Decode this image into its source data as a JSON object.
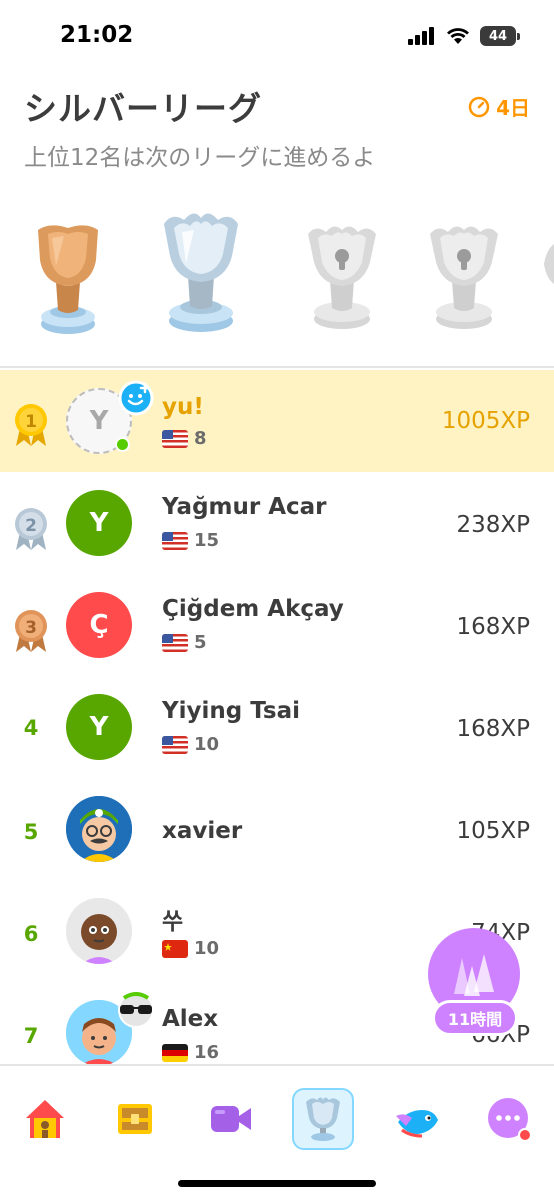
{
  "status_bar": {
    "time": "21:02",
    "battery": "44"
  },
  "header": {
    "title": "シルバーリーグ",
    "subtitle": "上位12名は次のリーグに進めるよ",
    "timer": "4日"
  },
  "trophies": [
    {
      "name": "bronze",
      "state": "unlocked"
    },
    {
      "name": "silver",
      "state": "current"
    },
    {
      "name": "locked-1",
      "state": "locked"
    },
    {
      "name": "locked-2",
      "state": "locked"
    }
  ],
  "leaderboard": [
    {
      "rank": "1",
      "name": "yu!",
      "initial": "Y",
      "streak": "8",
      "xp": "1005XP",
      "flag": "us",
      "me": true
    },
    {
      "rank": "2",
      "name": "Yağmur Acar",
      "initial": "Y",
      "streak": "15",
      "xp": "238XP",
      "flag": "us",
      "color": "#58a700"
    },
    {
      "rank": "3",
      "name": "Çiğdem Akçay",
      "initial": "Ç",
      "streak": "5",
      "xp": "168XP",
      "flag": "us",
      "color": "#ff4b4b"
    },
    {
      "rank": "4",
      "name": "Yiying Tsai",
      "initial": "Y",
      "streak": "10",
      "xp": "168XP",
      "flag": "us",
      "color": "#58a700"
    },
    {
      "rank": "5",
      "name": "xavier",
      "xp": "105XP"
    },
    {
      "rank": "6",
      "name": "쑤",
      "streak": "10",
      "xp": "74XP",
      "flag": "cn"
    },
    {
      "rank": "7",
      "name": "Alex",
      "streak": "16",
      "xp": "66XP",
      "flag": "de"
    }
  ],
  "float_button": {
    "timer": "11時間"
  },
  "bottom_nav": [
    {
      "name": "home",
      "active": false
    },
    {
      "name": "chest",
      "active": false
    },
    {
      "name": "video",
      "active": false
    },
    {
      "name": "leagues",
      "active": true
    },
    {
      "name": "bird",
      "active": false
    },
    {
      "name": "more",
      "active": false
    }
  ],
  "colors": {
    "accent_orange": "#ff9600",
    "highlight": "#fff3c4",
    "green": "#58a700",
    "purple": "#ce82ff"
  }
}
